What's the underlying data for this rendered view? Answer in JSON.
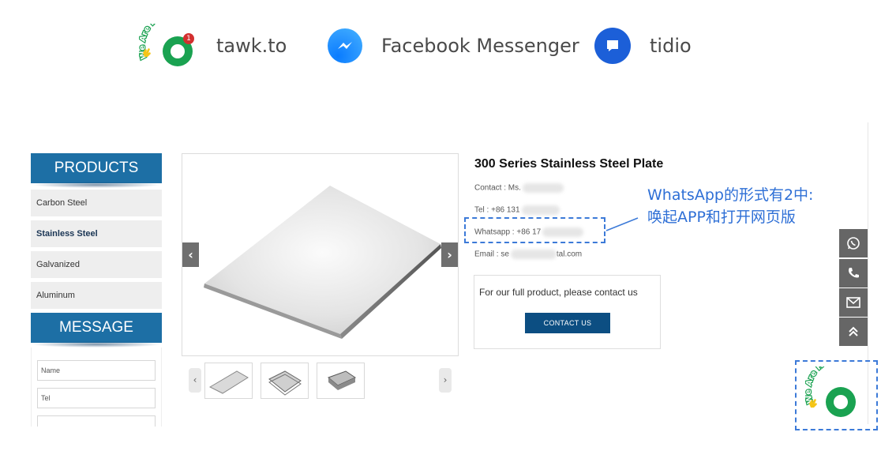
{
  "legend": [
    {
      "name": "tawk.to",
      "icon": "tawk-icon"
    },
    {
      "name": "Facebook Messenger",
      "icon": "messenger-icon"
    },
    {
      "name": "tidio",
      "icon": "tidio-icon"
    }
  ],
  "tawk_badge": "We Are Here!",
  "tawk_badge_count": "1",
  "sidebar": {
    "products_title": "PRODUCTS",
    "items": [
      "Carbon Steel",
      "Stainless Steel",
      "Galvanized",
      "Aluminum"
    ],
    "active_item": "Stainless Steel",
    "message_title": "MESSAGE",
    "form_fields": [
      "Name",
      "Tel"
    ]
  },
  "product": {
    "title": "300 Series Stainless Steel Plate",
    "contact_label": "Contact : Ms.",
    "tel_label": "Tel : +86 131",
    "whatsapp_label": "Whatsapp : +86 17",
    "email_prefix": "Email : se",
    "email_suffix": "tal.com",
    "cta_text": "For our full product, please contact us",
    "cta_button": "CONTACT US"
  },
  "gallery": {
    "prev_arrow": "‹",
    "next_arrow": "›",
    "thumb_prev": "‹",
    "thumb_next": "›"
  },
  "annotation": {
    "line1": "WhatsApp的形式有2中:",
    "line2": "唤起APP和打开网页版"
  },
  "floating_buttons": [
    "whatsapp-icon",
    "phone-icon",
    "mail-icon",
    "scroll-top-icon"
  ],
  "widget_badge": "We Are Here!",
  "colors": {
    "sidebar_header": "#1d6fa5",
    "cta_button": "#0c4e82",
    "annotation": "#2e6fd6",
    "tawk_green": "#1aa251",
    "messenger_blue": "#1a8cff",
    "tidio_blue": "#1c5fd8",
    "float_gray": "#666666"
  }
}
